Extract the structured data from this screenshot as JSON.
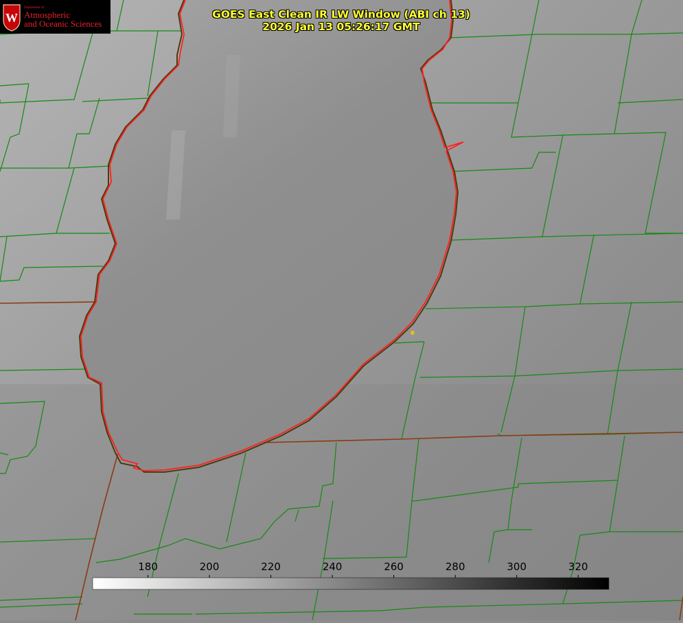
{
  "header": {
    "title_line1": "GOES East Clean IR LW Window (ABI ch 13)",
    "title_line2": "2026 Jan 13 05:26:17 GMT"
  },
  "logo": {
    "department_of": "Department of",
    "line1": "Atmospheric",
    "line2": "and Oceanic Sciences",
    "crest_letter": "W"
  },
  "colorbar": {
    "ticks": [
      "180",
      "200",
      "220",
      "240",
      "260",
      "280",
      "300",
      "320"
    ],
    "tick_values": [
      180,
      200,
      220,
      240,
      260,
      280,
      300,
      320
    ],
    "min": 162,
    "max": 330,
    "color_low": "#ffffff",
    "color_high": "#000000"
  },
  "colors": {
    "title": "#ffff33",
    "county_lines": "#138a13",
    "state_lines": "#8a3a14",
    "lake_coastline": "#ff2020",
    "marker": "#e0c020"
  }
}
